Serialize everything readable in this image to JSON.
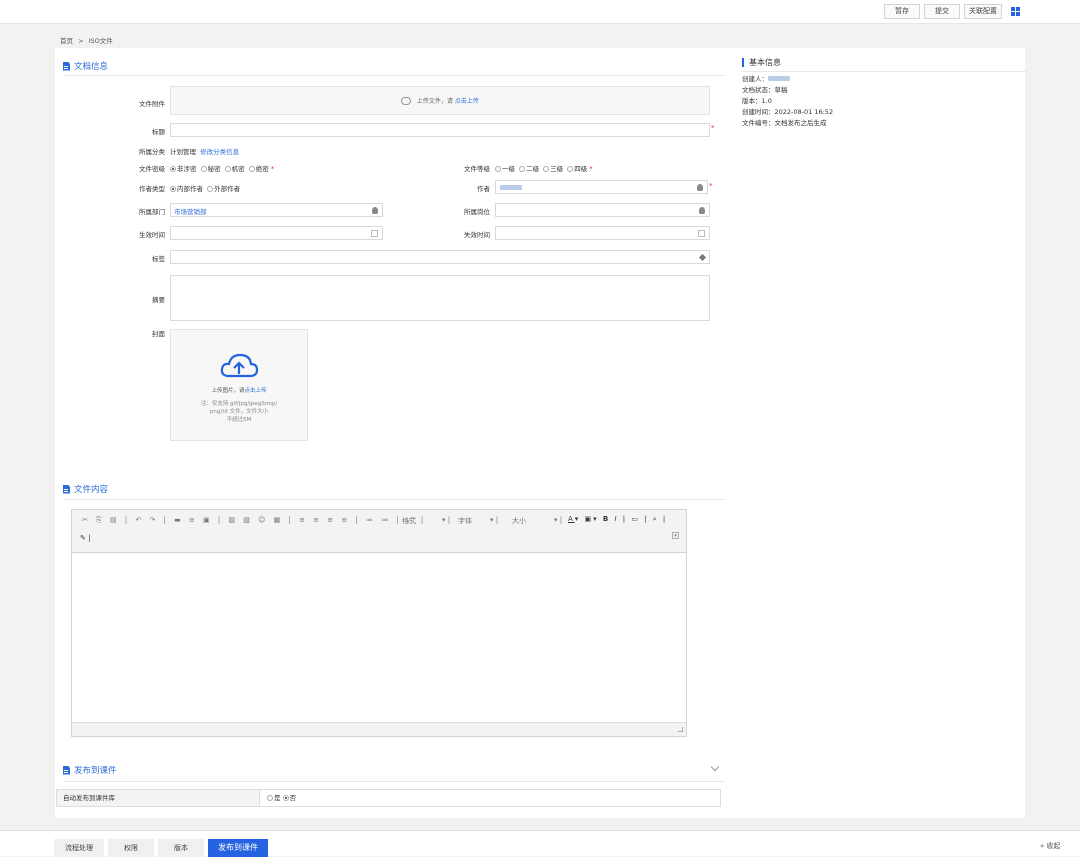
{
  "toolbar": {
    "save_label": "暂存",
    "submit_label": "提交",
    "relate_label": "关联配置"
  },
  "breadcrumb": {
    "home": "首页",
    "sep": ">",
    "current": "ISO文件"
  },
  "sections": {
    "doc_info": "文档信息",
    "content": "文件内容",
    "publish": "发布到课件"
  },
  "form": {
    "attachment_label": "文件附件",
    "upload_text": "上传文件，请",
    "upload_link": "点击上传",
    "title_label": "标题",
    "category_label": "所属分类",
    "category_value": "计划管理",
    "category_link": "修改分类信息",
    "secret_label": "文件密级",
    "secret_options": [
      "非涉密",
      "秘密",
      "机密",
      "绝密"
    ],
    "secret_selected": 0,
    "level_label": "文件等级",
    "level_options": [
      "一级",
      "二级",
      "三级",
      "四级"
    ],
    "author_type_label": "作者类型",
    "author_type_options": [
      "内部作者",
      "外部作者"
    ],
    "author_type_selected": 0,
    "author_label": "作者",
    "dept_label": "所属部门",
    "dept_value": "市场营销部",
    "post_label": "所属岗位",
    "effective_label": "生效时间",
    "expire_label": "失效时间",
    "tag_label": "标签",
    "summary_label": "摘要",
    "cover_label": "封面",
    "cover_upload_text": "上传图片，请",
    "cover_upload_link": "点击上传",
    "cover_note_1": "注：仅支持 gif/jpg/jpeg/bmp/",
    "cover_note_2": "png/tif 文件，文件大小",
    "cover_note_3": "不超过5M",
    "required_mark": "*"
  },
  "editor": {
    "format_label": "格式",
    "font_label": "字体",
    "size_label": "大小"
  },
  "publish": {
    "auto_label": "自动发布到课件库",
    "options": [
      "是",
      "否"
    ],
    "selected": 1
  },
  "bottom_tabs": [
    "流程处理",
    "权限",
    "版本",
    "发布到课件"
  ],
  "bottom_active": 3,
  "collapse_label": "收起",
  "basic_info": {
    "title": "基本信息",
    "creator_label": "创建人：",
    "status_label": "文档状态：",
    "status_value": "草稿",
    "version_label": "版本：",
    "version_value": "1.0",
    "created_label": "创建时间：",
    "created_value": "2022-08-01 16:52",
    "number_label": "文件编号：",
    "number_value": "文档发布之后生成"
  },
  "colors": {
    "accent": "#2563e0",
    "link": "#2d6cd8",
    "required": "#e33333"
  }
}
